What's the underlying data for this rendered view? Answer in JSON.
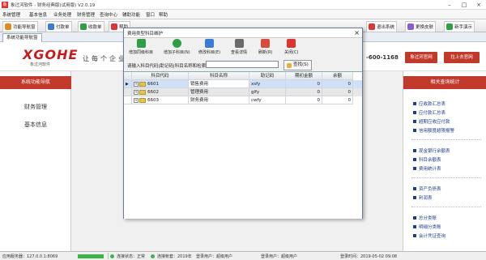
{
  "window": {
    "title": "象过河软件 - 财务经典版(试用版) V2.0.19",
    "app_icon": "象"
  },
  "menubar": [
    "系统管理",
    "基本信息",
    "业务处理",
    "财务管理",
    "查询中心",
    "辅助功能",
    "窗口",
    "帮助"
  ],
  "toolbar": [
    {
      "label": "功能导航窗",
      "icon": "home-icon",
      "color": "#e08a1e"
    },
    {
      "label": "付款单",
      "icon": "payment-icon",
      "color": "#3a7bd5"
    },
    {
      "label": "收款单",
      "icon": "receipt-icon",
      "color": "#2f9e44"
    },
    {
      "label": "帮助",
      "icon": "help-icon",
      "color": "#d33"
    },
    {
      "label": "退出系统",
      "icon": "exit-icon",
      "color": "#d33"
    },
    {
      "label": "更换皮肤",
      "icon": "skin-icon",
      "color": "#8a5cd1"
    },
    {
      "label": "新手演示",
      "icon": "demo-icon",
      "color": "#2f9e44"
    }
  ],
  "tabstrip": {
    "active_tab": "系统功能导航窗"
  },
  "banner": {
    "logo": "XGOHE",
    "logo_sub": "象过河软件",
    "slogan": "让每个企业",
    "phone": "-600-1168",
    "btn_official": "象过河官网",
    "btn_forum": "拉上去官网"
  },
  "leftpanel": {
    "header": "系统功能导航",
    "items": [
      "财务管理",
      "基本信息"
    ]
  },
  "rightpanel": {
    "header": "相关查询统计",
    "groups": [
      [
        "应收款汇总表",
        "应付款汇总表",
        "超期应收应付款",
        "信用额度超限报警"
      ],
      [
        "现金银行余额表",
        "科目余额表",
        "费用统计表"
      ],
      [
        "资产负债表",
        "利润表"
      ],
      [
        "总分类账",
        "明细分类账",
        "会计凭证查询"
      ]
    ]
  },
  "dialog": {
    "title": "费用类型科目维护",
    "close": "×",
    "tools": [
      {
        "label": "增加同级科目",
        "icon": "add-sibling-icon",
        "color": "#2f9e44"
      },
      {
        "label": "增加子科目(N)",
        "icon": "add-child-icon",
        "color": "#2f9e44"
      },
      {
        "label": "修改科目(E)",
        "icon": "edit-icon",
        "color": "#3a7bd5"
      },
      {
        "label": "查看详情",
        "icon": "detail-icon",
        "color": "#6a6a6a"
      },
      {
        "label": "刷新(R)",
        "icon": "refresh-icon",
        "color": "#d94c3d"
      },
      {
        "label": "关闭(C)",
        "icon": "close-icon",
        "color": "#d33"
      }
    ],
    "search_label": "请输入科目代码|助记码|科目名称和检索:",
    "search_value": "",
    "search_button": "查找(S)",
    "columns": [
      "科目代码",
      "科目名称",
      "助记码",
      "期初金额",
      "余额"
    ],
    "rows": [
      {
        "code": "6601",
        "name": "销售费用",
        "mnemonic": "xsfy",
        "opening": "0",
        "balance": "0",
        "selected": true
      },
      {
        "code": "6602",
        "name": "管理费用",
        "mnemonic": "glfy",
        "opening": "0",
        "balance": "0",
        "selected": false
      },
      {
        "code": "6603",
        "name": "财务费用",
        "mnemonic": "cwfy",
        "opening": "0",
        "balance": "0",
        "selected": false
      }
    ]
  },
  "statusbar": {
    "server_label": "应用服务器：127.0.0.1:8069",
    "conn1": "连接状态：正常",
    "book": "连接帐套：2019年",
    "user": "登录用户：超级用户",
    "user2": "登录用户：超级用户",
    "time_label": "登录时间：2019-05-02 09:08"
  }
}
